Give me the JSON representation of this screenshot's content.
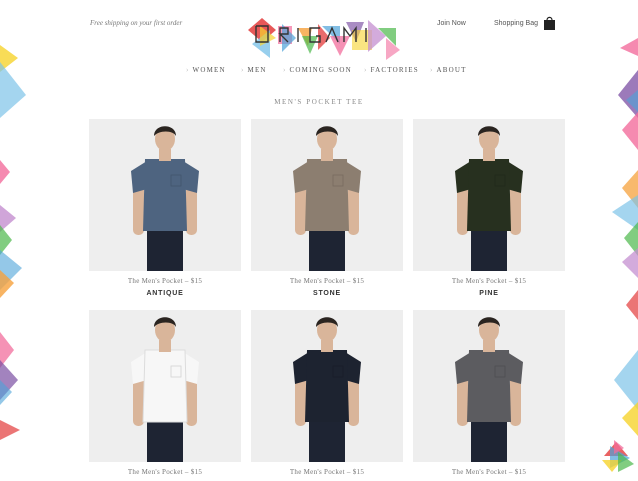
{
  "header": {
    "shipping_note": "Free shipping on your first order",
    "join_label": "Join Now",
    "bag_label": "Shopping Bag"
  },
  "nav": [
    {
      "label": "WOMEN"
    },
    {
      "label": "MEN"
    },
    {
      "label": "COMING SOON"
    },
    {
      "label": "FACTORIES"
    },
    {
      "label": "ABOUT"
    }
  ],
  "page_title": "MEN'S POCKET TEE",
  "products": [
    {
      "name": "The Men's Pocket – $15",
      "color": "ANTIQUE",
      "shirt_color": "#4e6480"
    },
    {
      "name": "The Men's Pocket – $15",
      "color": "STONE",
      "shirt_color": "#8c7e70"
    },
    {
      "name": "The Men's Pocket – $15",
      "color": "PINE",
      "shirt_color": "#27301f"
    },
    {
      "name": "The Men's Pocket – $15",
      "color": "",
      "shirt_color": "#f7f7f7"
    },
    {
      "name": "The Men's Pocket – $15",
      "color": "",
      "shirt_color": "#1d2330"
    },
    {
      "name": "The Men's Pocket – $15",
      "color": "",
      "shirt_color": "#5c5c60"
    }
  ],
  "colors": {
    "accent_pink": "#f26d9c",
    "accent_blue": "#4da3d9",
    "accent_yellow": "#f6d32d",
    "accent_purple": "#7b4ea3",
    "accent_red": "#e33b3b",
    "accent_green": "#4cb84a"
  },
  "icons": {
    "bag": "shopping-bag-icon"
  }
}
